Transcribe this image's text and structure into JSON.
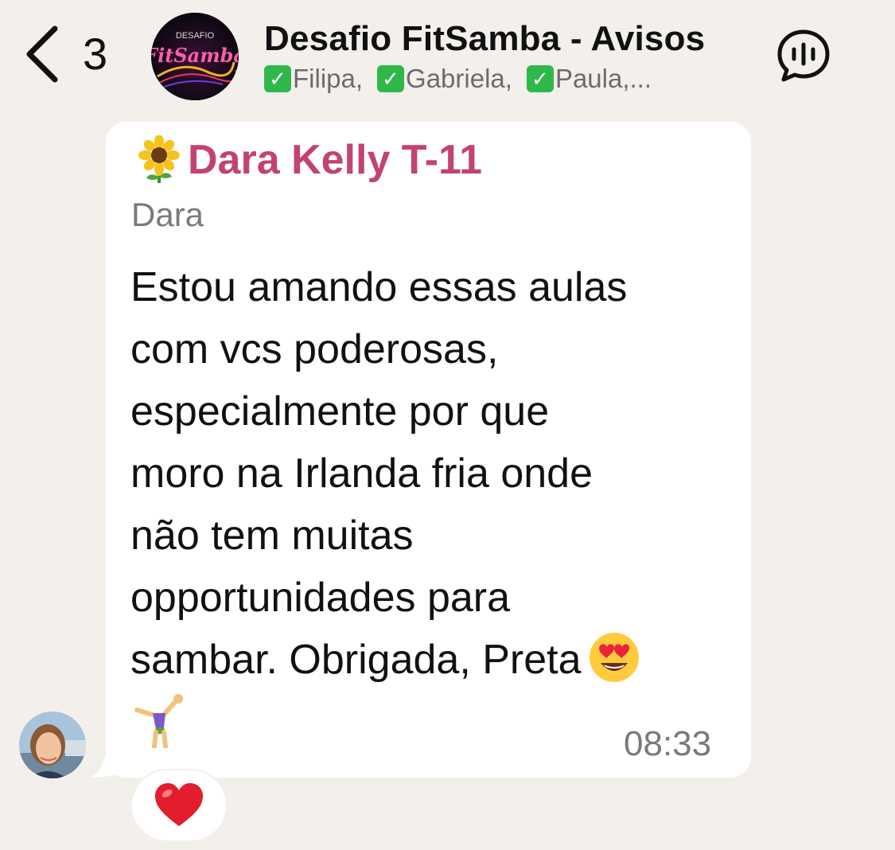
{
  "header": {
    "back_count": "3",
    "title": "Desafio FitSamba - Avisos",
    "subtitle_items": [
      "Filipa,",
      "Gabriela,",
      "Paula,..."
    ],
    "group_logo_text": "DESAFIO",
    "group_logo_script": "FitSamba"
  },
  "message": {
    "sender": "Dara Kelly T-11",
    "push_name": "Dara",
    "lines": [
      "Estou amando essas aulas",
      "com vcs poderosas,",
      "especialmente por que",
      "moro na Irlanda fria onde",
      "não tem muitas",
      "opportunidades para",
      "sambar. Obrigada, Preta"
    ],
    "time": "08:33",
    "reaction": "heart"
  },
  "colors": {
    "background": "#f3f0ec",
    "bubble": "#ffffff",
    "sender_name": "#c2446e",
    "meta_gray": "#7a7a7a",
    "check_green": "#2fb84a"
  },
  "icons": [
    "chevron-left-icon",
    "voice-call-icon",
    "sunflower-icon",
    "heart-eyes-emoji",
    "cartwheel-emoji",
    "heart-icon"
  ]
}
